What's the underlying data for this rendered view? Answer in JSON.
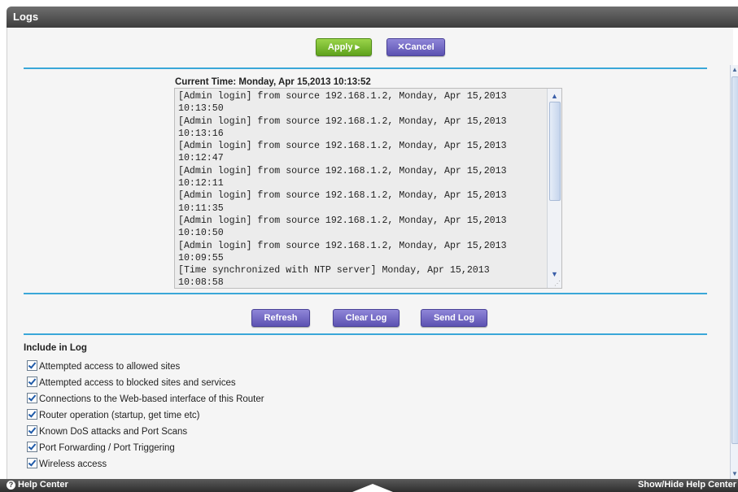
{
  "window": {
    "title": "Logs"
  },
  "actions": {
    "apply_label": "Apply ▸",
    "cancel_label": "✕Cancel"
  },
  "log": {
    "current_time": "Current Time: Monday, Apr 15,2013 10:13:52",
    "entries": "[Admin login] from source 192.168.1.2, Monday, Apr 15,2013\n10:13:50\n[Admin login] from source 192.168.1.2, Monday, Apr 15,2013\n10:13:16\n[Admin login] from source 192.168.1.2, Monday, Apr 15,2013\n10:12:47\n[Admin login] from source 192.168.1.2, Monday, Apr 15,2013\n10:12:11\n[Admin login] from source 192.168.1.2, Monday, Apr 15,2013\n10:11:35\n[Admin login] from source 192.168.1.2, Monday, Apr 15,2013\n10:10:50\n[Admin login] from source 192.168.1.2, Monday, Apr 15,2013\n10:09:55\n[Time synchronized with NTP server] Monday, Apr 15,2013\n10:08:58"
  },
  "log_actions": {
    "refresh_label": "Refresh",
    "clear_label": "Clear Log",
    "send_label": "Send Log"
  },
  "include": {
    "title": "Include in Log",
    "options": [
      {
        "label": "Attempted access to allowed sites",
        "checked": true
      },
      {
        "label": "Attempted access to blocked sites and services",
        "checked": true
      },
      {
        "label": "Connections to the Web-based interface of this Router",
        "checked": true
      },
      {
        "label": "Router operation (startup, get time etc)",
        "checked": true
      },
      {
        "label": "Known DoS attacks and Port Scans",
        "checked": true
      },
      {
        "label": "Port Forwarding / Port Triggering",
        "checked": true
      },
      {
        "label": "Wireless access",
        "checked": true
      }
    ]
  },
  "footer": {
    "help_center": "Help Center",
    "show_hide": "Show/Hide Help Center"
  }
}
